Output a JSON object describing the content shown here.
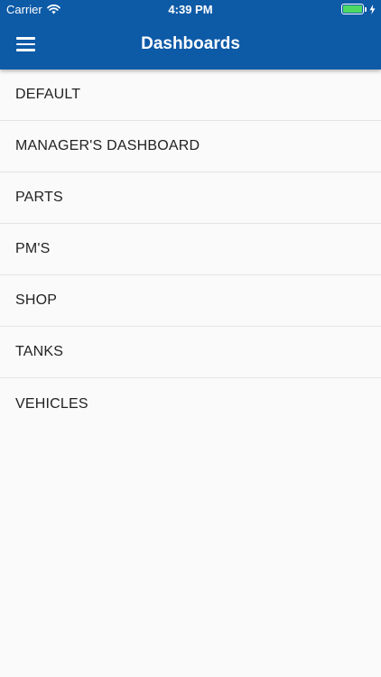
{
  "status_bar": {
    "carrier": "Carrier",
    "time": "4:39 PM",
    "battery_level": 1.0,
    "battery_color": "#4cd964",
    "wifi_icon": "wifi-icon",
    "charging_icon": "lightning-bolt-icon"
  },
  "header": {
    "title": "Dashboards",
    "background_color": "#0d5aa7",
    "menu_icon": "hamburger-menu-icon"
  },
  "dashboards": {
    "items": [
      {
        "label": "DEFAULT"
      },
      {
        "label": "MANAGER'S DASHBOARD"
      },
      {
        "label": "PARTS"
      },
      {
        "label": "PM'S"
      },
      {
        "label": "SHOP"
      },
      {
        "label": "TANKS"
      },
      {
        "label": "VEHICLES"
      }
    ]
  }
}
